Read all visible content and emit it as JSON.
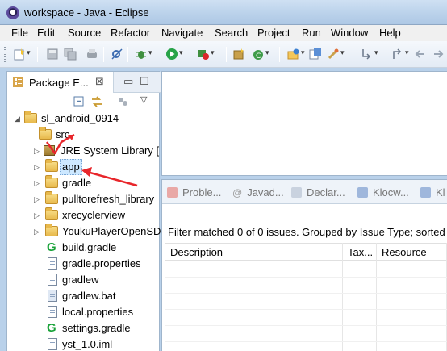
{
  "window": {
    "title": "workspace - Java - Eclipse"
  },
  "menu": [
    "File",
    "Edit",
    "Source",
    "Refactor",
    "Navigate",
    "Search",
    "Project",
    "Run",
    "Window",
    "Help"
  ],
  "package_explorer": {
    "tab_label": "Package E...",
    "close_glyph": "⊠",
    "tree": [
      {
        "label": "sl_android_0914",
        "icon": "project-icon",
        "twisty": "expanded"
      },
      {
        "label": "src",
        "icon": "package-folder-icon",
        "twisty": ""
      },
      {
        "label": "JRE System Library [",
        "icon": "library-icon",
        "twisty": "collapsed"
      },
      {
        "label": "app",
        "icon": "folder-icon",
        "twisty": "collapsed",
        "selected": true
      },
      {
        "label": "gradle",
        "icon": "folder-icon",
        "twisty": "collapsed"
      },
      {
        "label": "pulltorefresh_library",
        "icon": "folder-icon",
        "twisty": "collapsed"
      },
      {
        "label": "xrecyclerview",
        "icon": "folder-icon",
        "twisty": "collapsed"
      },
      {
        "label": "YoukuPlayerOpenSD",
        "icon": "folder-icon",
        "twisty": "collapsed"
      },
      {
        "label": "build.gradle",
        "icon": "gradle-icon",
        "twisty": ""
      },
      {
        "label": "gradle.properties",
        "icon": "file-icon",
        "twisty": ""
      },
      {
        "label": "gradlew",
        "icon": "file-icon",
        "twisty": ""
      },
      {
        "label": "gradlew.bat",
        "icon": "batch-file-icon",
        "twisty": ""
      },
      {
        "label": "local.properties",
        "icon": "file-icon",
        "twisty": ""
      },
      {
        "label": "settings.gradle",
        "icon": "gradle-icon",
        "twisty": ""
      },
      {
        "label": "yst_1.0.iml",
        "icon": "file-icon",
        "twisty": ""
      }
    ]
  },
  "bottom_tabs": [
    {
      "label": "Proble...",
      "icon": "problems-icon",
      "color": "#c0504d"
    },
    {
      "label": "Javad...",
      "icon": "javadoc-icon",
      "color": "#8c8c8c"
    },
    {
      "label": "Declar...",
      "icon": "declaration-icon",
      "color": "#8a9bb5"
    },
    {
      "label": "Klocw...",
      "icon": "klocwork-icon",
      "color": "#3f6fb5"
    },
    {
      "label": "Kl",
      "icon": "klocwork-icon",
      "color": "#3f6fb5"
    }
  ],
  "problems": {
    "filter_text": "Filter matched 0 of 0 issues. Grouped by Issue Type; sorted",
    "columns": [
      "Description",
      "Tax...",
      "Resource"
    ]
  },
  "colors": {
    "selection": "#cde8ff",
    "annotation_arrow": "#e8262b",
    "window_frame": "#b9d1ea"
  }
}
